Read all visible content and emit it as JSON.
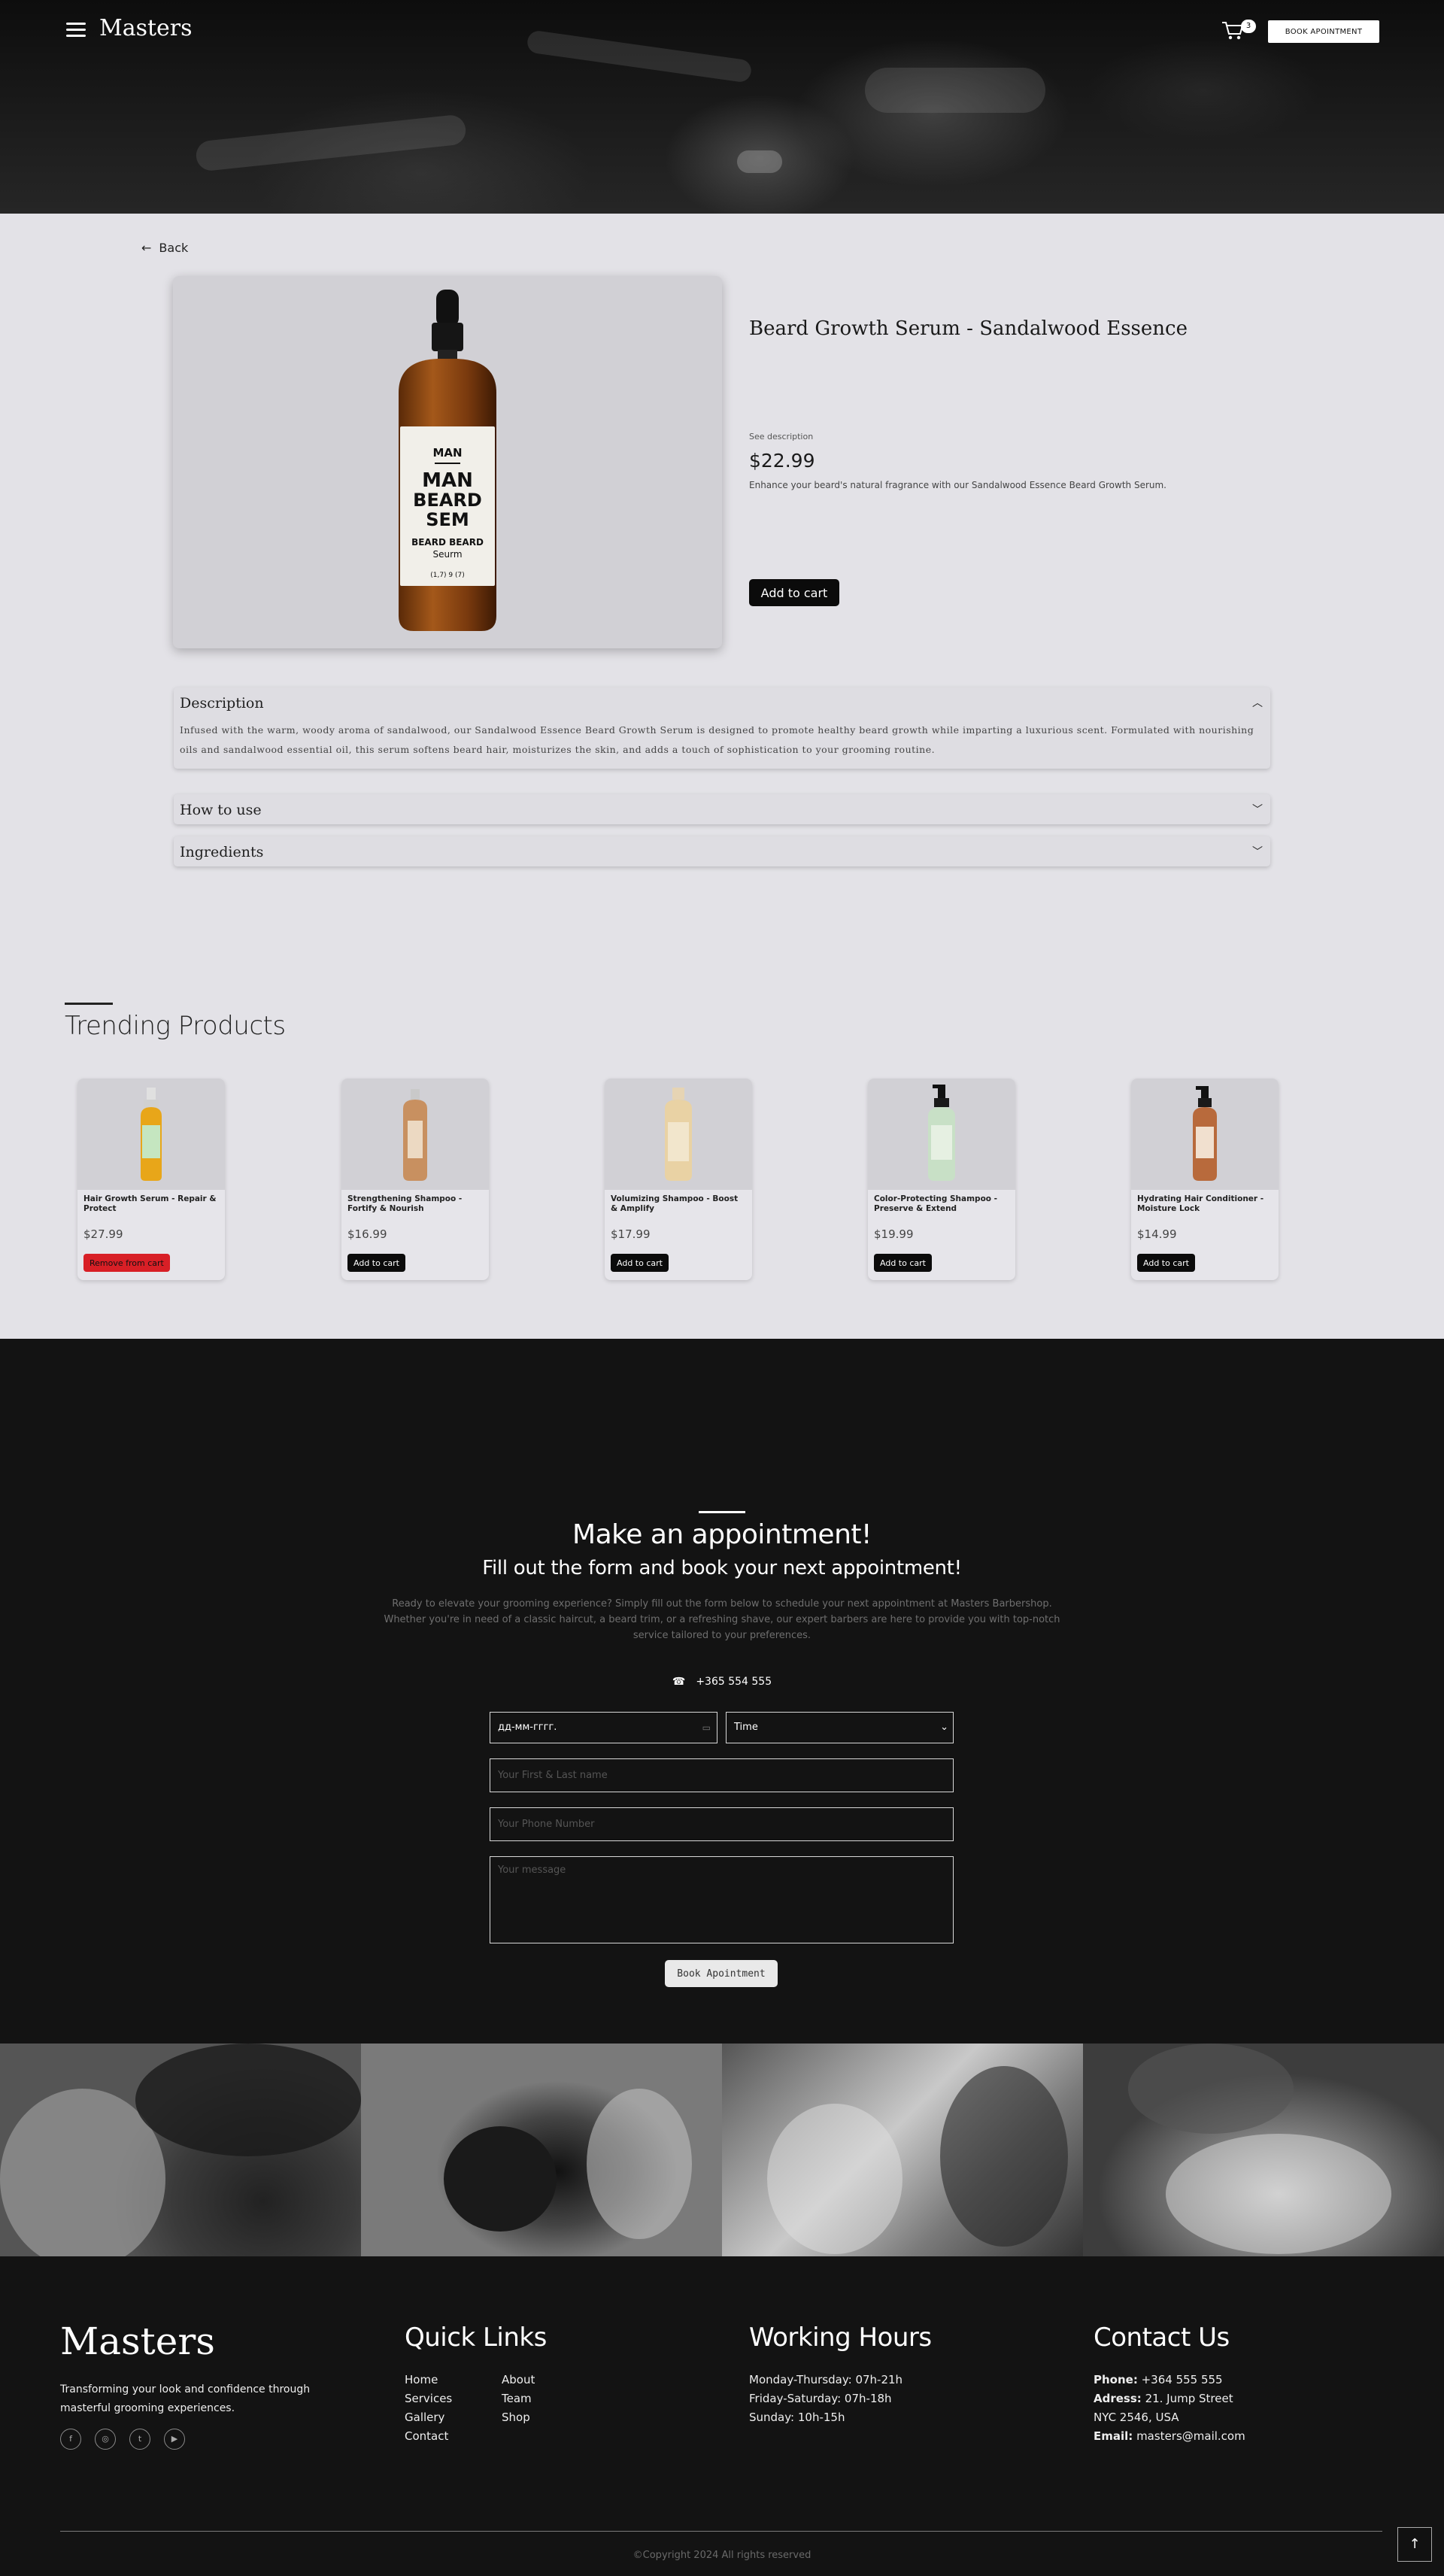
{
  "header": {
    "logo": "Masters",
    "cart_count": "3",
    "book_button": "BOOK APOINTMENT",
    "menu_icon": "hamburger-menu-icon",
    "cart_icon": "shopping-cart-icon"
  },
  "product": {
    "back_label": "Back",
    "title": "Beard Growth Serum - Sandalwood Essence",
    "see_description": "See description",
    "price": "$22.99",
    "short_description": "Enhance your beard's natural fragrance with our Sandalwood Essence Beard Growth Serum.",
    "add_to_cart": "Add to cart",
    "bottle_label": {
      "top": "MAN",
      "line1": "MAN",
      "line2": "BEARD",
      "line3": "SEM",
      "line4": "BEARD BEARD",
      "line5": "Seurm",
      "footer": "(1,7) 9 (7)"
    }
  },
  "accordion": {
    "description": {
      "title": "Description",
      "body": "Infused with the warm, woody aroma of sandalwood, our Sandalwood Essence Beard Growth Serum is designed to promote healthy beard growth while imparting a luxurious scent. Formulated with nourishing oils and sandalwood essential oil, this serum softens beard hair, moisturizes the skin, and adds a touch of sophistication to your grooming routine."
    },
    "how_to_use": {
      "title": "How to use"
    },
    "ingredients": {
      "title": "Ingredients"
    }
  },
  "trending": {
    "title": "Trending Products",
    "items": [
      {
        "name": "Hair Growth Serum - Repair & Protect",
        "price": "$27.99",
        "button": "Remove from cart",
        "bottle_color": "#e8a619",
        "label_color": "#c5e6c0"
      },
      {
        "name": "Strengthening Shampoo - Fortify & Nourish",
        "price": "$16.99",
        "button": "Add to cart",
        "bottle_color": "#c89060",
        "label_color": "#ecd9c2"
      },
      {
        "name": "Volumizing Shampoo - Boost & Amplify",
        "price": "$17.99",
        "button": "Add to cart",
        "bottle_color": "#e9d2a4",
        "label_color": "#f2e6cc"
      },
      {
        "name": "Color-Protecting Shampoo - Preserve & Extend",
        "price": "$19.99",
        "button": "Add to cart",
        "bottle_color": "#c8e0c6",
        "label_color": "#e6f0e2"
      },
      {
        "name": "Hydrating Hair Conditioner - Moisture Lock",
        "price": "$14.99",
        "button": "Add to cart",
        "bottle_color": "#b86a3c",
        "label_color": "#f1e0cf"
      }
    ]
  },
  "appointment": {
    "title": "Make an appointment!",
    "subtitle": "Fill out the form and book your next appointment!",
    "text": "Ready to elevate your grooming experience? Simply fill out the form below to schedule your next appointment at Masters Barbershop. Whether you're in need of a classic haircut, a beard trim, or a refreshing shave, our expert barbers are here to provide you with top-notch service tailored to your preferences.",
    "phone": "+365 554 555",
    "date_placeholder": "дд-мм-гггг.",
    "time_label": "Time",
    "name_placeholder": "Your First & Last name",
    "phone_placeholder": "Your Phone Number",
    "message_placeholder": "Your message",
    "submit": "Book Apointment"
  },
  "footer": {
    "logo": "Masters",
    "tagline": "Transforming your look and confidence through masterful grooming experiences.",
    "social_icons": [
      "facebook-icon",
      "instagram-icon",
      "twitter-icon",
      "youtube-icon"
    ],
    "quick_links_title": "Quick Links",
    "links_col1": [
      "Home",
      "Services",
      "Gallery",
      "Contact"
    ],
    "links_col2": [
      "About",
      "Team",
      "Shop"
    ],
    "hours_title": "Working Hours",
    "hours": [
      "Monday-Thursday: 07h-21h",
      "Friday-Saturday: 07h-18h",
      "Sunday: 10h-15h"
    ],
    "contact_title": "Contact Us",
    "phone_label": "Phone:",
    "phone_value": "+364 555 555",
    "address_label": "Adress:",
    "address_value": "21. Jump Street",
    "city": "NYC 2546, USA",
    "email_label": "Email:",
    "email_value": "masters@mail.com",
    "copyright": "©Copyright 2024 All rights reserved"
  }
}
